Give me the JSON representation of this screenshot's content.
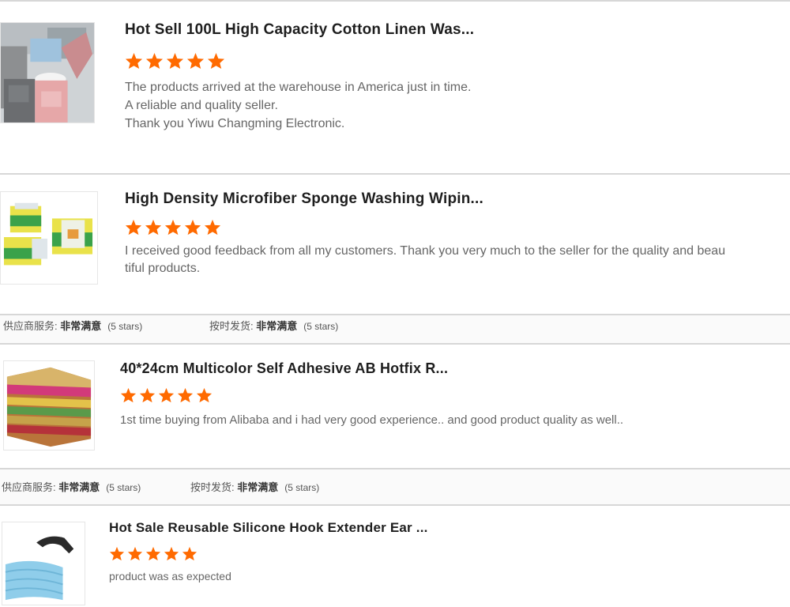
{
  "reviews": [
    {
      "product_title": "Hot Sell 100L High Capacity Cotton Linen Was...",
      "stars": 5,
      "comment_lines": [
        "The products arrived at the warehouse in America just in time.",
        "A reliable and quality seller.",
        "Thank you Yiwu Changming Electronic."
      ]
    },
    {
      "product_title": "High Density Microfiber Sponge Washing Wipin...",
      "stars": 5,
      "comment_lines": [
        "I received good feedback from all my customers. Thank you very much to the seller for the quality and beau",
        "tiful products."
      ]
    },
    {
      "product_title": "40*24cm Multicolor Self Adhesive AB Hotfix R...",
      "stars": 5,
      "comment_lines": [
        "1st time buying from Alibaba and i had very good experience.. and good product quality as well.."
      ]
    },
    {
      "product_title": "Hot Sale Reusable Silicone Hook Extender Ear ...",
      "stars": 5,
      "comment_lines": [
        "product was as expected"
      ]
    }
  ],
  "rating_bars": [
    {
      "service_label": "供应商服务: ",
      "service_value": "非常满意",
      "service_stars": "(5 stars)",
      "shipping_label": "按时发货: ",
      "shipping_value": "非常满意",
      "shipping_stars": "(5 stars)"
    },
    {
      "service_label": "供应商服务: ",
      "service_value": "非常满意",
      "service_stars": "(5 stars)",
      "shipping_label": "按时发货: ",
      "shipping_value": "非常满意",
      "shipping_stars": "(5 stars)"
    }
  ],
  "colors": {
    "star": "#ff6a00",
    "divider": "#d7d7d7",
    "comment_text": "#666666"
  },
  "icons": {
    "star": "star-icon"
  }
}
